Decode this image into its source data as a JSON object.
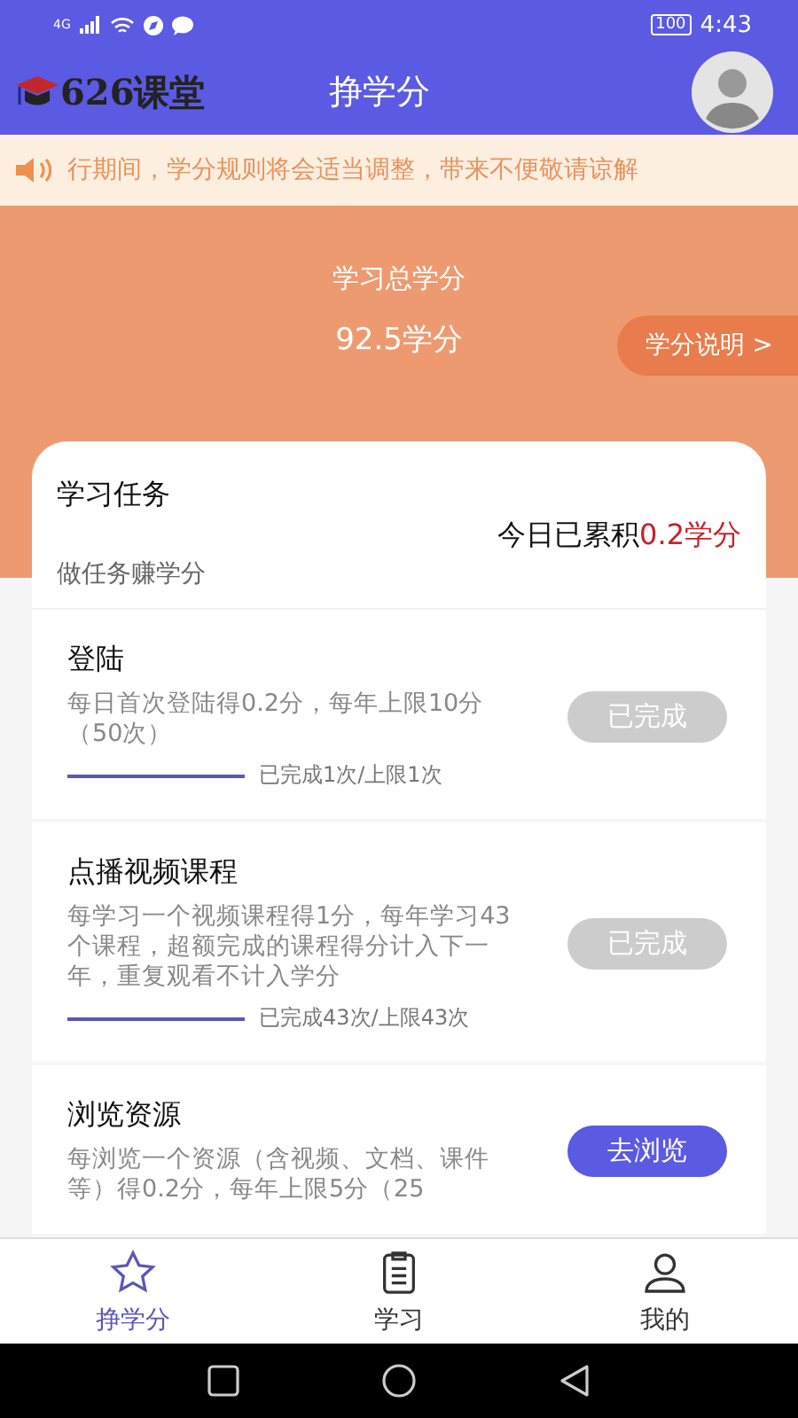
{
  "status_bar": {
    "battery": "100",
    "time": "4:43",
    "network": "4G"
  },
  "header": {
    "logo": "626课堂",
    "title": "挣学分"
  },
  "notice": {
    "text": "行期间，学分规则将会适当调整，带来不便敬请谅解"
  },
  "summary": {
    "label": "学习总学分",
    "value": "92.5学分",
    "explain_button": "学分说明 >"
  },
  "tasks_card": {
    "title": "学习任务",
    "subtitle": "做任务赚学分",
    "today_label": "今日已累积",
    "today_value": "0.2学分"
  },
  "tasks": [
    {
      "title": "登陆",
      "description": "每日首次登陆得0.2分，每年上限10分（50次）",
      "level": 1,
      "progress": "已完成1次/上限1次",
      "button": "已完成",
      "completed": true
    },
    {
      "title": "点播视频课程",
      "description": "每学习一个视频课程得1分，每年学习43个课程，超额完成的课程得分计入下一年，重复观看不计入学分",
      "level": 1,
      "progress": "已完成43次/上限43次",
      "button": "已完成",
      "completed": true
    },
    {
      "title": "浏览资源",
      "description": "每浏览一个资源（含视频、文档、课件等）得0.2分，每年上限5分（25",
      "button": "去浏览",
      "completed": false
    }
  ],
  "tab_bar": [
    {
      "label": "挣学分",
      "kind": "star",
      "selected": true
    },
    {
      "label": "学习",
      "kind": "clipboard",
      "selected": false
    },
    {
      "label": "我的",
      "kind": "user",
      "selected": false
    }
  ]
}
